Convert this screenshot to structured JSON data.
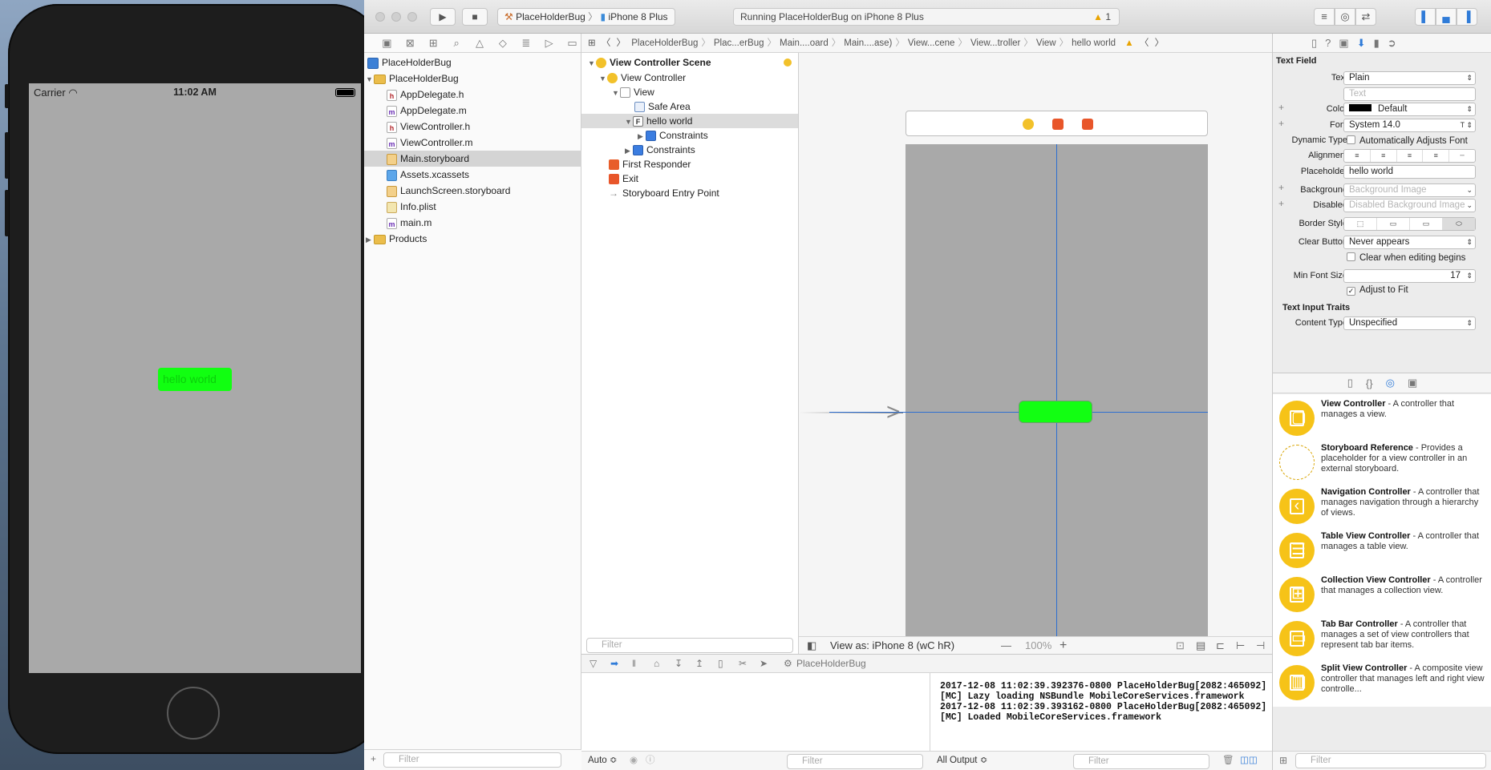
{
  "simulator": {
    "carrier": "Carrier",
    "time": "11:02 AM",
    "field_text": "hello world"
  },
  "toolbar": {
    "run_icon": "play-icon",
    "stop_icon": "stop-icon",
    "scheme_name": "PlaceHolderBug",
    "device_name": "iPhone 8 Plus",
    "activity": "Running PlaceHolderBug on iPhone 8 Plus",
    "warning_count": "1"
  },
  "navigator": {
    "project": "PlaceHolderBug",
    "group": "PlaceHolderBug",
    "files": [
      {
        "name": "AppDelegate.h",
        "type": "h"
      },
      {
        "name": "AppDelegate.m",
        "type": "m"
      },
      {
        "name": "ViewController.h",
        "type": "h"
      },
      {
        "name": "ViewController.m",
        "type": "m"
      },
      {
        "name": "Main.storyboard",
        "type": "storyboard",
        "selected": true
      },
      {
        "name": "Assets.xcassets",
        "type": "assets"
      },
      {
        "name": "LaunchScreen.storyboard",
        "type": "storyboard"
      },
      {
        "name": "Info.plist",
        "type": "plist"
      },
      {
        "name": "main.m",
        "type": "m"
      }
    ],
    "products": "Products",
    "filter_placeholder": "Filter"
  },
  "jumpbar": [
    "PlaceHolderBug",
    "Plac...erBug",
    "Main....oard",
    "Main....ase)",
    "View...cene",
    "View...troller",
    "View",
    "hello world"
  ],
  "outline": {
    "scene": "View Controller Scene",
    "view_controller": "View Controller",
    "view": "View",
    "safe_area": "Safe Area",
    "text_field": "hello world",
    "constraints_inner": "Constraints",
    "constraints_outer": "Constraints",
    "first_responder": "First Responder",
    "exit": "Exit",
    "entry_point": "Storyboard Entry Point",
    "filter_placeholder": "Filter"
  },
  "canvas": {
    "view_as": "View as: iPhone 8 (wC hR)",
    "zoom": "100%"
  },
  "debug": {
    "target": "PlaceHolderBug",
    "console_lines": [
      "2017-12-08 11:02:39.392376-0800 PlaceHolderBug[2082:465092]",
      "[MC] Lazy loading NSBundle MobileCoreServices.framework",
      "2017-12-08 11:02:39.393162-0800 PlaceHolderBug[2082:465092]",
      "[MC] Loaded MobileCoreServices.framework"
    ],
    "auto_label": "Auto ≎",
    "output_label": "All Output ≎",
    "filter_placeholder": "Filter"
  },
  "inspector": {
    "section_title": "Text Field",
    "text_label": "Text",
    "text_value": "Plain",
    "text_placeholder": "Text",
    "color_label": "Color",
    "color_value": "Default",
    "font_label": "Font",
    "font_value": "System 14.0",
    "dynamic_type_label": "Dynamic Type",
    "dynamic_type_check": "Automatically Adjusts Font",
    "alignment_label": "Alignment",
    "placeholder_label": "Placeholder",
    "placeholder_value": "hello world",
    "background_label": "Background",
    "background_value": "Background Image",
    "disabled_label": "Disabled",
    "disabled_value": "Disabled Background Image",
    "border_style_label": "Border Style",
    "clear_button_label": "Clear Button",
    "clear_button_value": "Never appears",
    "clear_editing_check": "Clear when editing begins",
    "min_font_label": "Min Font Size",
    "min_font_value": "17",
    "adjust_fit_check": "Adjust to Fit",
    "input_traits_title": "Text Input Traits",
    "content_type_label": "Content Type",
    "content_type_value": "Unspecified",
    "filter_placeholder": "Filter"
  },
  "library": [
    {
      "title": "View Controller",
      "desc": " - A controller that manages a view."
    },
    {
      "title": "Storyboard Reference",
      "desc": " - Provides a placeholder for a view controller in an external storyboard."
    },
    {
      "title": "Navigation Controller",
      "desc": " - A controller that manages navigation through a hierarchy of views."
    },
    {
      "title": "Table View Controller",
      "desc": " - A controller that manages a table view."
    },
    {
      "title": "Collection View Controller",
      "desc": " - A controller that manages a collection view."
    },
    {
      "title": "Tab Bar Controller",
      "desc": " - A controller that manages a set of view controllers that represent tab bar items."
    },
    {
      "title": "Split View Controller",
      "desc": " - A composite view controller that manages left and right view controlle..."
    }
  ]
}
